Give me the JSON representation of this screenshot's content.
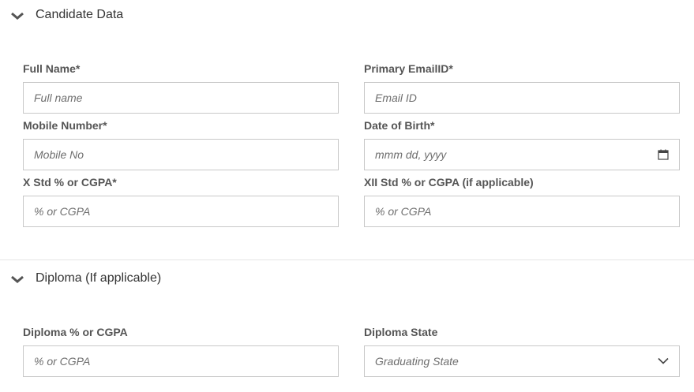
{
  "sections": {
    "candidate": {
      "title": "Candidate Data",
      "icon": "chevron-down-icon",
      "fields": {
        "full_name": {
          "label": "Full Name*",
          "placeholder": "Full name",
          "value": ""
        },
        "email": {
          "label": "Primary EmailID*",
          "placeholder": "Email ID",
          "value": ""
        },
        "mobile": {
          "label": "Mobile Number*",
          "placeholder": "Mobile No",
          "value": ""
        },
        "dob": {
          "label": "Date of Birth*",
          "placeholder": "mmm dd, yyyy",
          "value": "",
          "icon": "calendar-icon"
        },
        "x_std": {
          "label": "X Std % or CGPA*",
          "placeholder": "% or CGPA",
          "value": ""
        },
        "xii_std": {
          "label": "XII Std % or CGPA (if applicable)",
          "placeholder": "% or CGPA",
          "value": ""
        }
      }
    },
    "diploma": {
      "title": "Diploma (If applicable)",
      "icon": "chevron-down-icon",
      "fields": {
        "diploma_score": {
          "label": "Diploma % or CGPA",
          "placeholder": "% or CGPA",
          "value": ""
        },
        "diploma_state": {
          "label": "Diploma State",
          "selected": "Graduating State",
          "icon": "chevron-down-icon"
        }
      }
    }
  },
  "colors": {
    "label": "#555555",
    "border": "#c8c8c8",
    "divider": "#e6e6e6",
    "placeholder": "#6e6e6e"
  }
}
